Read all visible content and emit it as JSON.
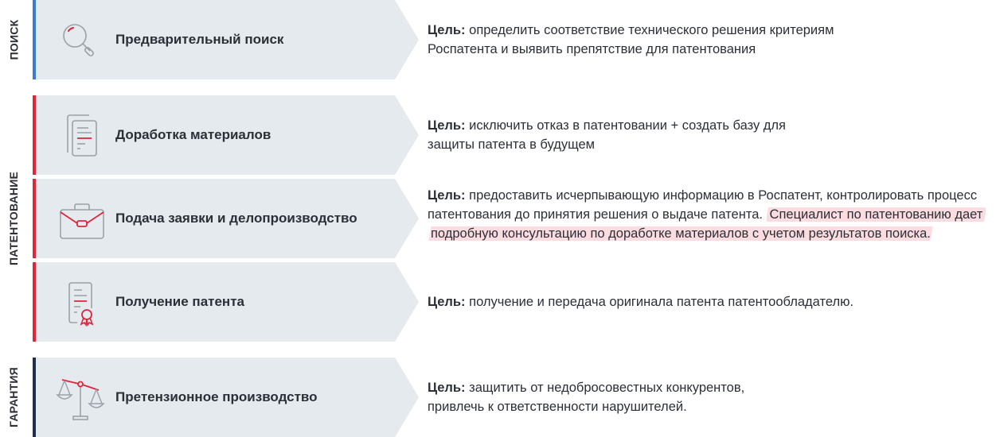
{
  "colors": {
    "search": "#3d7bd1",
    "patenting": "#e0243c",
    "guarantee": "#1e2f4a",
    "stage_bg": "#e5eaee",
    "highlight": "#fbdce0",
    "icon_gray": "#9aa1a8",
    "icon_red": "#e0243c"
  },
  "sections": [
    {
      "label": "ПОИСК"
    },
    {
      "label": "ПАТЕНТОВАНИЕ"
    },
    {
      "label": "ГАРАНТИЯ"
    }
  ],
  "stages": [
    {
      "icon": "magnifier-icon",
      "title": "Предварительный поиск",
      "goal_label": "Цель:",
      "goal_text": " определить соответствие технического решения критериям Роспатента и выявить препятствие для патентования",
      "goal_highlight": ""
    },
    {
      "icon": "documents-icon",
      "title": "Доработка материалов",
      "goal_label": "Цель:",
      "goal_text": " исключить отказ в патентовании + создать базу для защиты патента в будущем",
      "goal_highlight": ""
    },
    {
      "icon": "briefcase-icon",
      "title": "Подача заявки и делопроизводство",
      "goal_label": "Цель:",
      "goal_text": " предоставить исчерпывающую информацию в Роспатент, контролировать процесс патентования до принятия решения о выдаче патента. ",
      "goal_highlight": "Специалист по патентованию дает подробную консультацию по доработке материалов с учетом результатов поиска."
    },
    {
      "icon": "certificate-icon",
      "title": "Получение патента",
      "goal_label": "Цель:",
      "goal_text": " получение и передача оригинала патента патентообладателю.",
      "goal_highlight": ""
    },
    {
      "icon": "scales-icon",
      "title": "Претензионное производство",
      "goal_label": "Цель:",
      "goal_text": " защитить от недобросовестных конкурентов, привлечь к ответственности нарушителей.",
      "goal_highlight": ""
    }
  ]
}
